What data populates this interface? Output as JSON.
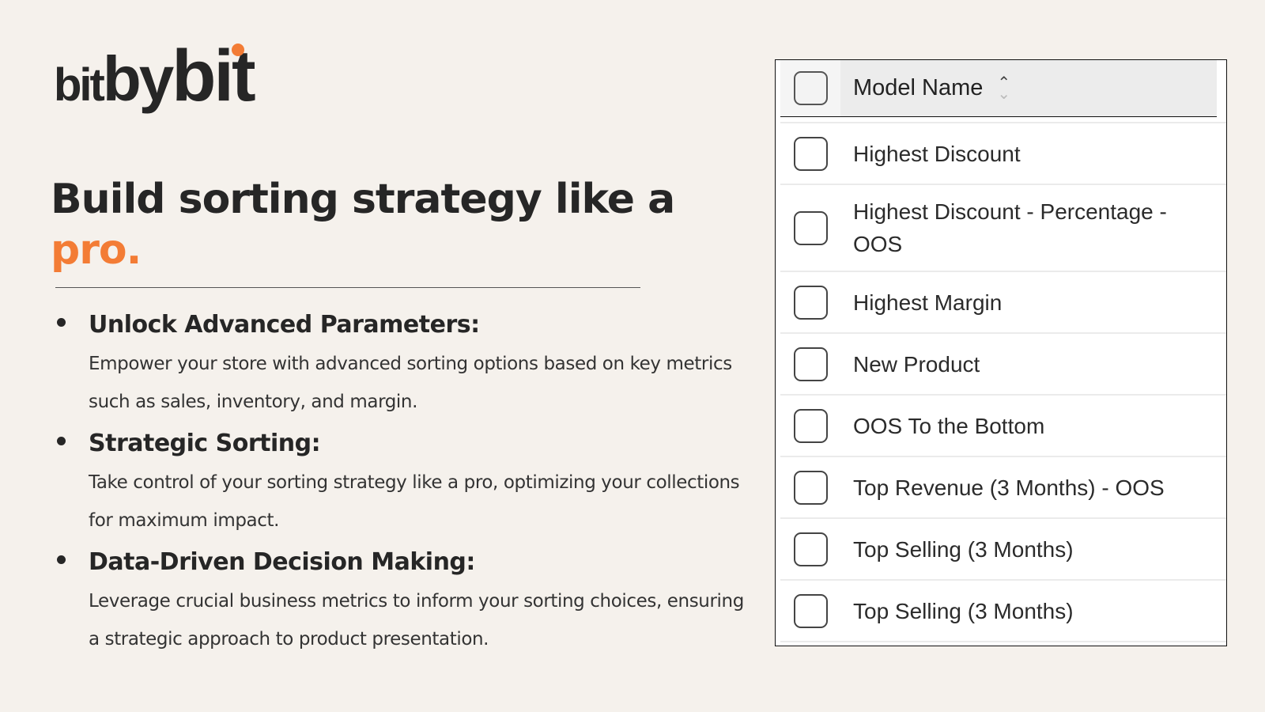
{
  "brand": {
    "logo_part1": "bit",
    "logo_part2": "by",
    "logo_part3": "bit",
    "accent_color": "#f37c35"
  },
  "headline": {
    "main": "Build sorting strategy like a",
    "accent": "pro."
  },
  "features": [
    {
      "title": "Unlock Advanced Parameters:",
      "description": "Empower your store with advanced sorting options based on key metrics such as sales, inventory, and margin."
    },
    {
      "title": "Strategic Sorting:",
      "description": "Take control of your sorting strategy like a pro, optimizing your collections for maximum impact."
    },
    {
      "title": "Data-Driven Decision Making:",
      "description": "Leverage crucial business metrics to inform your sorting choices, ensuring a strategic approach to product presentation."
    }
  ],
  "table": {
    "header": "Model Name",
    "sort_icon": "sort-chevrons-icon",
    "rows": [
      {
        "label": "Highest Discount",
        "checked": false
      },
      {
        "label": "Highest Discount - Percentage - OOS",
        "checked": false
      },
      {
        "label": "Highest Margin",
        "checked": false
      },
      {
        "label": "New Product",
        "checked": false
      },
      {
        "label": "OOS To the Bottom",
        "checked": false
      },
      {
        "label": "Top Revenue (3 Months) - OOS",
        "checked": false
      },
      {
        "label": "Top Selling (3 Months)",
        "checked": false
      },
      {
        "label": "Top Selling (3 Months)",
        "checked": false
      }
    ]
  }
}
